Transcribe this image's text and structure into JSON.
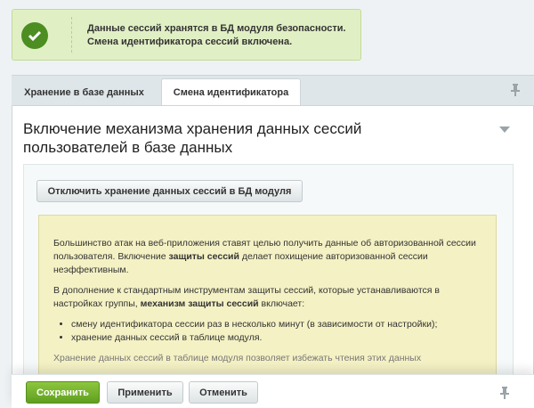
{
  "notice": {
    "line1": "Данные сессий хранятся в БД модуля безопасности.",
    "line2": "Смена идентификатора сессий включена."
  },
  "tabs": [
    {
      "label": "Хранение в базе данных",
      "active": true
    },
    {
      "label": "Смена идентификатора",
      "active": false
    }
  ],
  "panel": {
    "title_line1": "Включение механизма хранения данных сессий",
    "title_line2": "пользователей в базе данных",
    "disable_button": "Отключить хранение данных сессий в БД модуля"
  },
  "info": {
    "p1_pre": "Большинство атак на веб-приложения ставят целью получить данные об авторизованной сессии пользователя. Включение ",
    "p1_bold": "защиты сессий",
    "p1_post": " делает похищение авторизованной сессии неэффективным.",
    "p2_pre": "В дополнение к стандартным инструментам защиты сессий, которые устанавливаются в настройках группы, ",
    "p2_bold": "механизм защиты сессий",
    "p2_post": " включает:",
    "list": [
      "смену идентификатора сессии раз в несколько минут (в зависимости от настройки);",
      "хранение данных сессий в таблице модуля."
    ],
    "p3": "Хранение данных сессий в таблице модуля позволяет избежать чтения этих данных"
  },
  "footer": {
    "save": "Сохранить",
    "apply": "Применить",
    "cancel": "Отменить"
  },
  "colors": {
    "accent_green": "#5f9f1f",
    "notice_bg": "#e1f0c4",
    "info_bg": "#f4f1c4"
  },
  "icons": [
    "check-icon",
    "pin-icon",
    "collapse-arrow-icon"
  ]
}
